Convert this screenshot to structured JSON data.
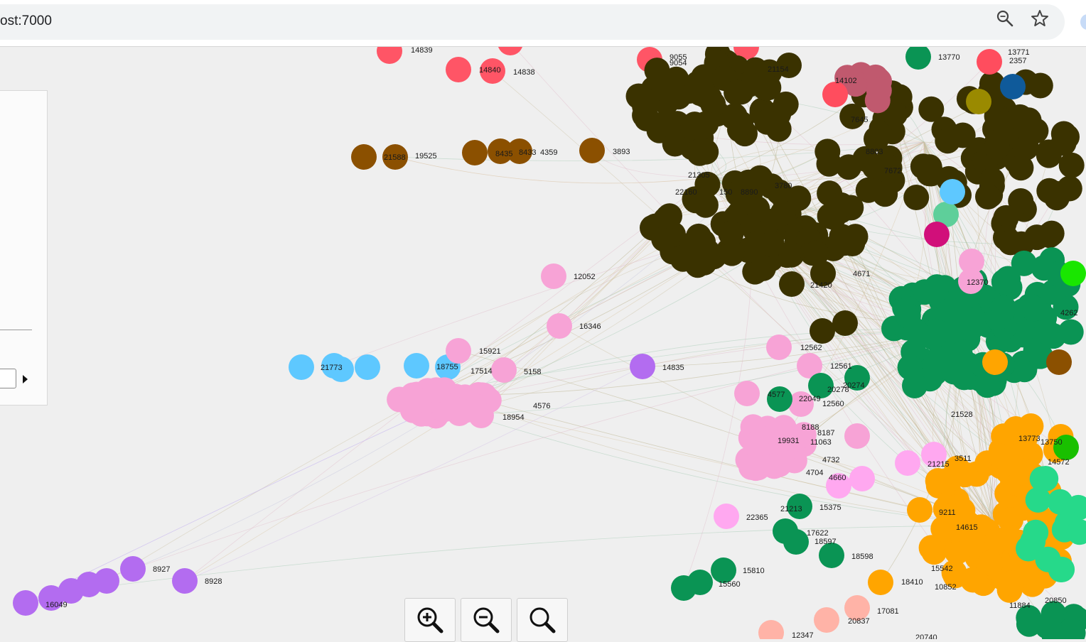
{
  "browser": {
    "url": "ost:7000",
    "zoom_icon": "magnifier-icon",
    "bookmark_icon": "star-icon"
  },
  "colors": {
    "background": "#efefef",
    "dark_olive": "#3a3200",
    "green": "#0a9454",
    "pink": "#f7a3d6",
    "orange": "#ffa500",
    "brown": "#8b5000",
    "sky": "#5ec8ff",
    "purple": "#b36cf0",
    "red": "#ff5566",
    "salmon": "#ffb3a7"
  },
  "zoom_controls": {
    "zoom_in_icon": "zoom-in-icon",
    "zoom_out_icon": "zoom-out-icon",
    "reset_icon": "zoom-reset-icon"
  },
  "graph": {
    "labels": [
      "14839",
      "14840",
      "14838",
      "9055",
      "9054",
      "21154",
      "14102",
      "13770",
      "2357",
      "13771",
      "21588",
      "19525",
      "8435",
      "8433",
      "4359",
      "3893",
      "7645",
      "8803",
      "7672",
      "3780",
      "21305",
      "22160",
      "150",
      "8890",
      "12052",
      "21420",
      "16346",
      "4671",
      "15921",
      "18755",
      "21773",
      "17514",
      "5158",
      "4576",
      "18954",
      "14835",
      "12562",
      "12561",
      "12560",
      "4577",
      "22049",
      "20274",
      "20278",
      "21528",
      "8188",
      "8187",
      "11063",
      "19931",
      "4732",
      "4704",
      "4660",
      "21215",
      "21213",
      "15375",
      "22365",
      "17622",
      "18597",
      "18598",
      "15810",
      "15560",
      "18410",
      "10852",
      "17081",
      "20837",
      "12347",
      "20740",
      "8928",
      "8927",
      "16049",
      "3511",
      "9211",
      "14615",
      "15542",
      "11884",
      "20850",
      "13773",
      "13750",
      "14572",
      "12370",
      "4262"
    ]
  }
}
